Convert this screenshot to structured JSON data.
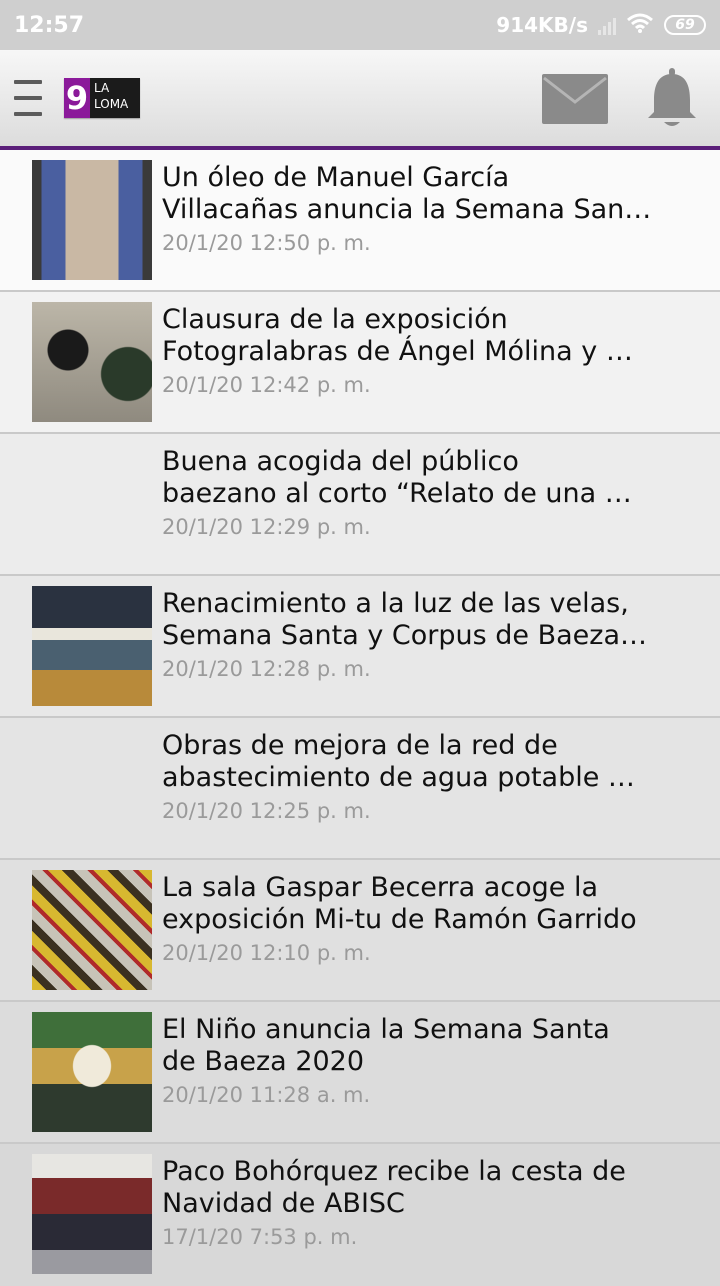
{
  "status_bar": {
    "time": "12:57",
    "speed": "914KB/s",
    "battery": "69"
  },
  "app_bar": {
    "logo_number": "9",
    "logo_text_1": "LA",
    "logo_text_2": "LOMA",
    "menu_icon": "menu-icon",
    "mail_icon": "mail-icon",
    "bell_icon": "bell-icon",
    "accent_color": "#5b1f7a"
  },
  "news": [
    {
      "title": "Un óleo de Manuel García\nVillacañas anuncia la Semana San…",
      "date": "20/1/20 12:50 p. m.",
      "has_image": true
    },
    {
      "title": "Clausura de la exposición\nFotogralabras de Ángel Mólina y …",
      "date": "20/1/20 12:42 p. m.",
      "has_image": true
    },
    {
      "title": "Buena acogida del público\nbaezano al corto “Relato de una …",
      "date": "20/1/20 12:29 p. m.",
      "has_image": false
    },
    {
      "title": "Renacimiento a la luz de las velas,\nSemana Santa y Corpus de Baeza…",
      "date": "20/1/20 12:28 p. m.",
      "has_image": true
    },
    {
      "title": "Obras de mejora de la red de\nabastecimiento de agua potable …",
      "date": "20/1/20 12:25 p. m.",
      "has_image": false
    },
    {
      "title": "La sala Gaspar Becerra acoge la\nexposición Mi-tu de Ramón Garrido",
      "date": "20/1/20 12:10 p. m.",
      "has_image": true
    },
    {
      "title": "El Niño anuncia la Semana Santa\nde Baeza 2020",
      "date": "20/1/20 11:28 a. m.",
      "has_image": true
    },
    {
      "title": "Paco Bohórquez recibe la cesta de\nNavidad de ABISC",
      "date": "17/1/20 7:53 p. m.",
      "has_image": true
    }
  ]
}
